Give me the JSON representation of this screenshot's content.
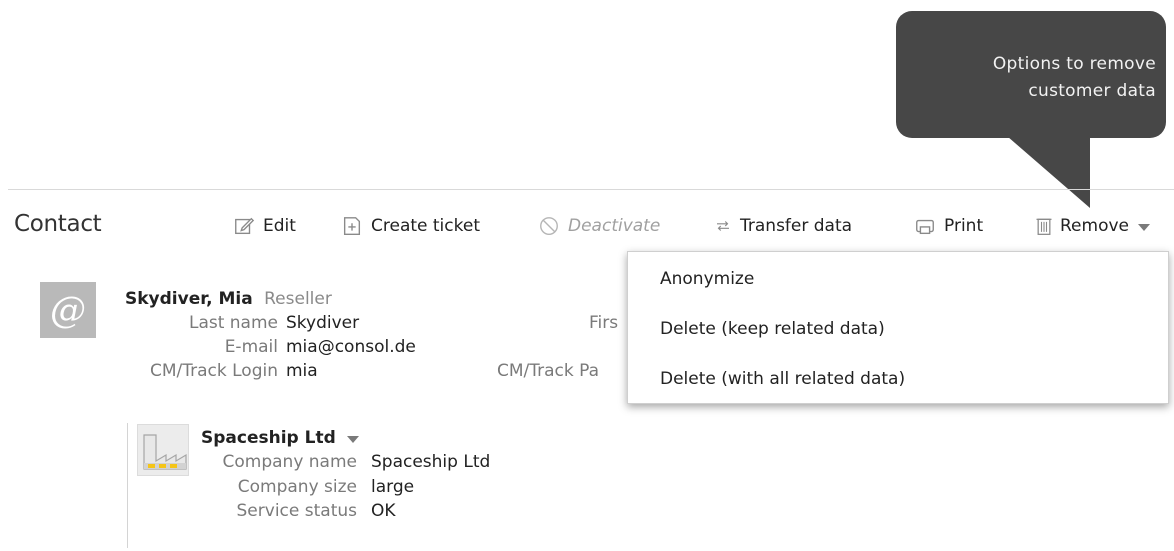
{
  "callout": {
    "line1": "Options to remove",
    "line2": "customer data"
  },
  "header": {
    "title": "Contact"
  },
  "toolbar": {
    "edit_label": "Edit",
    "create_ticket_label": "Create ticket",
    "deactivate_label": "Deactivate",
    "transfer_label": "Transfer data",
    "print_label": "Print",
    "remove_label": "Remove"
  },
  "contact": {
    "display_name": "Skydiver, Mia",
    "role": "Reseller",
    "fields": {
      "last_name_label": "Last name",
      "last_name_value": "Skydiver",
      "email_label": "E-mail",
      "email_value": "mia@consol.de",
      "login_label": "CM/Track Login",
      "login_value": "mia",
      "first_name_label_partial": "Firs",
      "password_label_partial": "CM/Track Pa"
    }
  },
  "company": {
    "header_name": "Spaceship Ltd",
    "name_label": "Company name",
    "name_value": "Spaceship Ltd",
    "size_label": "Company size",
    "size_value": "large",
    "status_label": "Service status",
    "status_value": "OK"
  },
  "remove_menu": {
    "items": [
      "Anonymize",
      "Delete (keep related data)",
      "Delete (with all related data)"
    ]
  },
  "colors": {
    "callout_bg": "#474747",
    "avatar_bg": "#b9b9b9",
    "company_window": "#f5c518",
    "disabled_text": "#a0a0a0"
  }
}
